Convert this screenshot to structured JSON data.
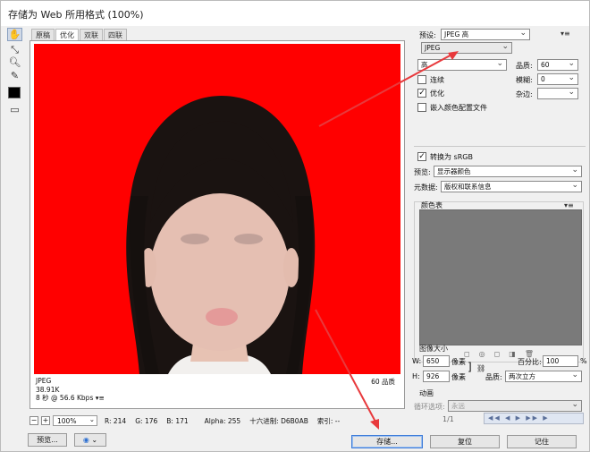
{
  "window": {
    "title": "存储为 Web 所用格式 (100%)"
  },
  "preview": {
    "tabs": [
      {
        "label": "原稿"
      },
      {
        "label": "优化"
      },
      {
        "label": "双联"
      },
      {
        "label": "四联"
      }
    ],
    "info": {
      "format": "JPEG",
      "size": "38.91K",
      "download": "8 秒 @ 56.6 Kbps",
      "quality_label": "60 品质"
    }
  },
  "statusbar": {
    "zoom": "100%",
    "r": "R: 214",
    "g": "G: 176",
    "b": "B: 171",
    "alpha": "Alpha: 255",
    "hex": "十六进制: D6B0AB",
    "index": "索引: --"
  },
  "bottom": {
    "preview_button": "预览...",
    "save_button": "存储...",
    "reset_button": "复位",
    "remember_button": "记住"
  },
  "settings": {
    "preset_label": "预设:",
    "preset_value": "JPEG 高",
    "format_value": "JPEG",
    "quality_level": "高",
    "quality_label": "品质:",
    "quality_value": "60",
    "progressive_label": "连续",
    "progressive_checked": false,
    "blur_label": "模糊:",
    "blur_value": "0",
    "optimized_label": "优化",
    "optimized_checked": true,
    "matte_label": "杂边:",
    "embed_profile_label": "嵌入颜色配置文件",
    "embed_profile_checked": false,
    "convert_srgb_label": "转换为 sRGB",
    "convert_srgb_checked": true,
    "preview_label": "预览:",
    "preview_value": "显示器颜色",
    "metadata_label": "元数据:",
    "metadata_value": "版权和联系信息",
    "color_table_label": "颜色表"
  },
  "image_size": {
    "header": "图像大小",
    "w_label": "W:",
    "w_value": "650",
    "h_label": "H:",
    "h_value": "926",
    "unit": "像素",
    "percent_label": "百分比:",
    "percent_value": "100",
    "percent_sign": "%",
    "quality_label": "品质:",
    "quality_value": "两次立方"
  },
  "animation": {
    "header": "动画",
    "loop_label": "循环选项:",
    "loop_value": "永远",
    "frame": "1/1"
  },
  "colors": {
    "photo_bg": "#ff0000",
    "annotation_arrow": "#e8393c"
  }
}
